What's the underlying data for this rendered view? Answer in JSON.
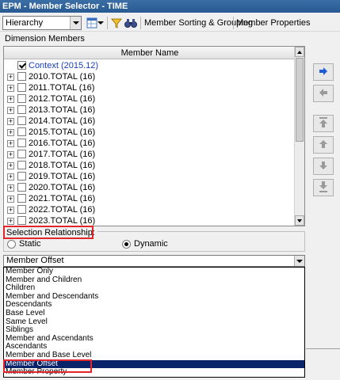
{
  "window": {
    "title": "EPM - Member Selector - TIME"
  },
  "toolbar": {
    "view_combo_value": "Hierarchy",
    "sorting_label": "Member Sorting & Grouping",
    "properties_label": "Member Properties"
  },
  "dimension_members": {
    "section_label": "Dimension Members",
    "column_header": "Member Name",
    "rows": [
      {
        "label": "Context (2015.12)",
        "checked": true,
        "expandable": false
      },
      {
        "label": "2010.TOTAL (16)",
        "checked": false,
        "expandable": true
      },
      {
        "label": "2011.TOTAL (16)",
        "checked": false,
        "expandable": true
      },
      {
        "label": "2012.TOTAL (16)",
        "checked": false,
        "expandable": true
      },
      {
        "label": "2013.TOTAL (16)",
        "checked": false,
        "expandable": true
      },
      {
        "label": "2014.TOTAL (16)",
        "checked": false,
        "expandable": true
      },
      {
        "label": "2015.TOTAL (16)",
        "checked": false,
        "expandable": true
      },
      {
        "label": "2016.TOTAL (16)",
        "checked": false,
        "expandable": true
      },
      {
        "label": "2017.TOTAL (16)",
        "checked": false,
        "expandable": true
      },
      {
        "label": "2018.TOTAL (16)",
        "checked": false,
        "expandable": true
      },
      {
        "label": "2019.TOTAL (16)",
        "checked": false,
        "expandable": true
      },
      {
        "label": "2020.TOTAL (16)",
        "checked": false,
        "expandable": true
      },
      {
        "label": "2021.TOTAL (16)",
        "checked": false,
        "expandable": true
      },
      {
        "label": "2022.TOTAL (16)",
        "checked": false,
        "expandable": true
      },
      {
        "label": "2023.TOTAL (16)",
        "checked": false,
        "expandable": true
      }
    ]
  },
  "selection_relationship": {
    "label": "Selection Relationship:",
    "static_label": "Static",
    "dynamic_label": "Dynamic",
    "selected_mode": "Dynamic",
    "combo_value": "Member Offset",
    "options": [
      "Member Only",
      "Member and Children",
      "Children",
      "Member and Descendants",
      "Descendants",
      "Base Level",
      "Same Level",
      "Siblings",
      "Member and Ascendants",
      "Ascendants",
      "Member and Base Level",
      "Member Offset",
      "Member Property"
    ],
    "highlighted_option": "Member Offset"
  },
  "colors": {
    "title_bar": "#2a5a93",
    "context_text": "#1a3fb8",
    "highlight_box": "#e3262b",
    "selected_item_bg": "#0a246a",
    "arrow_blue": "#1f5bd6"
  },
  "icons": {
    "layout": "layout-grid-icon",
    "filter": "filter-funnel-icon",
    "find": "binoculars-icon",
    "add": "arrow-right-icon",
    "remove": "arrow-left-icon",
    "move_top": "move-top-icon",
    "move_up": "move-up-icon",
    "move_down": "move-down-icon",
    "move_bottom": "move-bottom-icon"
  }
}
